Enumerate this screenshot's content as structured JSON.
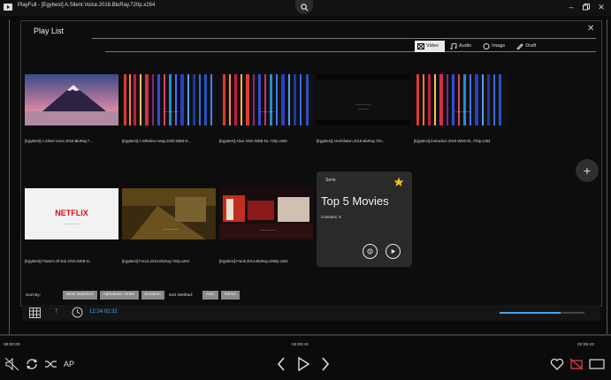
{
  "window": {
    "title": "PlayFull - [Egybest] A.Silent.Voice.2016.BluRay.720p.x264",
    "logo_icon": "play-logo-icon",
    "controls": [
      "minimize-icon",
      "restore-icon",
      "close-icon"
    ]
  },
  "playlist": {
    "title": "Play List",
    "tabs": [
      {
        "label": "Video",
        "icon": "video-icon",
        "active": true
      },
      {
        "label": "Audio",
        "icon": "music-icon",
        "active": false
      },
      {
        "label": "Image",
        "icon": "image-icon",
        "active": false
      },
      {
        "label": "Draft",
        "icon": "draft-icon",
        "active": false
      }
    ],
    "items": [
      {
        "caption": "[EgyBest].A.Silent.Voice.2016.BluRay.7...",
        "thumb": "mountain"
      },
      {
        "caption": "[EgyBest].A.Whisker.Away.2020.WEB-D...",
        "thumb": "stripes-a"
      },
      {
        "caption": "[EgyBest].Alive.2020.WEB-DL.720p.x265",
        "thumb": "stripes-b"
      },
      {
        "caption": "[EgyBest].Annihilation.2018.BluRay.720...",
        "thumb": "dark"
      },
      {
        "caption": "[EgyBest].Extraction.2020.WEB-DL.720p.x264",
        "thumb": "stripes-c"
      },
      {
        "caption": "[EgyBest].Flowers.Of.Evil.2019.WEB-D...",
        "thumb": "netflix",
        "thumb_text": "NETFLIX"
      },
      {
        "caption": "[EgyBest].Focus.2015.BluRay.720p.x264",
        "thumb": "room"
      },
      {
        "caption": "[EgyBest].Frank.2014.BluRay.1080p.x264",
        "thumb": "red-room"
      }
    ],
    "card": {
      "tag": "Serie",
      "title": "Top 5 Movies",
      "contains_label": "Contains: 5",
      "star_icon": "star-icon",
      "star_color": "#f5c518"
    },
    "sort": {
      "sort_by_label": "Sort By:",
      "options": [
        "Most Watched",
        "Alphabetic Order",
        "Duration"
      ],
      "method_label": "Sort Method:",
      "methods": [
        "ASC",
        "DESC"
      ]
    },
    "footer": {
      "count": "7",
      "total_duration": "12:24:02:32",
      "progress_fraction": 0.72
    }
  },
  "player": {
    "time_left": "00:00:00",
    "time_center": "02:09:43",
    "time_right": "02:09:43",
    "ap_label": "AP",
    "accent": "#4aa3e8"
  }
}
